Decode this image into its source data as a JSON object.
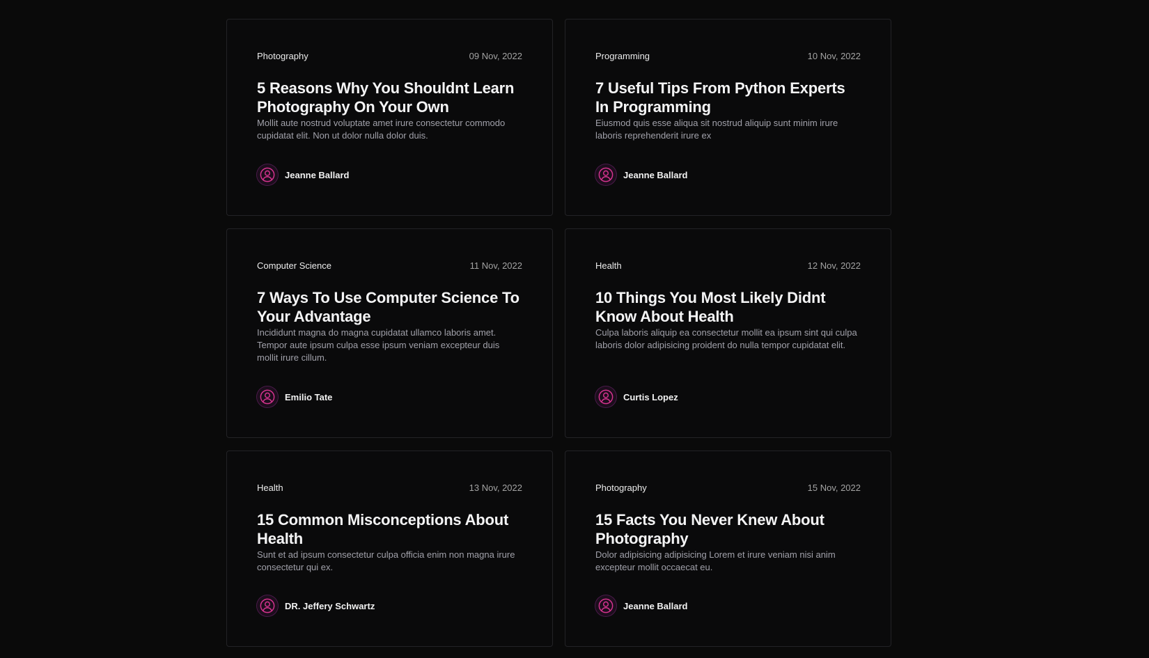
{
  "posts": [
    {
      "category": "Photography",
      "date": "09 Nov, 2022",
      "title": "5 Reasons Why You Shouldnt Learn Photography On Your Own",
      "excerpt": "Mollit aute nostrud voluptate amet irure consectetur commodo cupidatat elit. Non ut dolor nulla dolor duis.",
      "author": "Jeanne Ballard",
      "avatar_icon": "user-avatar-icon"
    },
    {
      "category": "Programming",
      "date": "10 Nov, 2022",
      "title": "7 Useful Tips From Python Experts In Programming",
      "excerpt": "Eiusmod quis esse aliqua sit nostrud aliquip sunt minim irure laboris reprehenderit irure ex",
      "author": "Jeanne Ballard",
      "avatar_icon": "user-avatar-icon"
    },
    {
      "category": "Computer Science",
      "date": "11 Nov, 2022",
      "title": "7 Ways To Use Computer Science To Your Advantage",
      "excerpt": "Incididunt magna do magna cupidatat ullamco laboris amet. Tempor aute ipsum culpa esse ipsum veniam excepteur duis mollit irure cillum.",
      "author": "Emilio Tate",
      "avatar_icon": "user-avatar-icon"
    },
    {
      "category": "Health",
      "date": "12 Nov, 2022",
      "title": "10 Things You Most Likely Didnt Know About Health",
      "excerpt": "Culpa laboris aliquip ea consectetur mollit ea ipsum sint qui culpa laboris dolor adipisicing proident do nulla tempor cupidatat elit.",
      "author": "Curtis Lopez",
      "avatar_icon": "user-avatar-icon"
    },
    {
      "category": "Health",
      "date": "13 Nov, 2022",
      "title": "15 Common Misconceptions About Health",
      "excerpt": "Sunt et ad ipsum consectetur culpa officia enim non magna irure consectetur qui ex.",
      "author": "DR. Jeffery Schwartz",
      "avatar_icon": "user-avatar-icon"
    },
    {
      "category": "Photography",
      "date": "15 Nov, 2022",
      "title": "15 Facts You Never Knew About Photography",
      "excerpt": "Dolor adipisicing adipisicing Lorem et irure veniam nisi anim excepteur mollit occaecat eu.",
      "author": "Jeanne Ballard",
      "avatar_icon": "user-avatar-icon"
    }
  ],
  "colors": {
    "background": "#0a0a0a",
    "card_border": "#232326",
    "avatar_accent": "#d6338f"
  }
}
